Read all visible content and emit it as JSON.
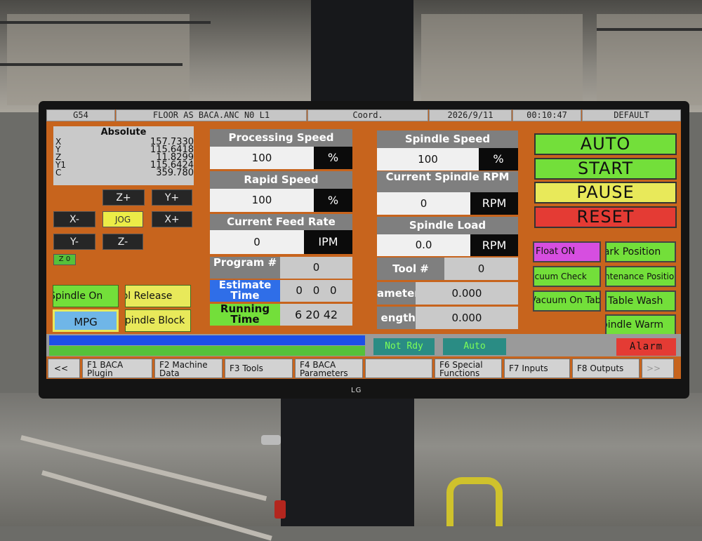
{
  "header": {
    "work_offset": "G54",
    "program_file": "FLOOR AS BACA.ANC N0 L1",
    "coord_label": "Coord.",
    "date": "2026/9/11",
    "time": "00:10:47",
    "profile": "DEFAULT"
  },
  "absolute": {
    "title": "Absolute",
    "axes": [
      "X",
      "Y",
      "Z",
      "Y1",
      "C"
    ],
    "values": [
      "157.7330",
      "115.6418",
      "11.8299",
      "115.6424",
      "359.780"
    ]
  },
  "jog": {
    "z_plus": "Z+",
    "y_plus": "Y+",
    "x_minus": "X-",
    "jog": "JOG",
    "x_plus": "X+",
    "y_minus": "Y-",
    "z_minus": "Z-",
    "z0": "Z 0"
  },
  "left_buttons": {
    "spindle_on": "Spindle On",
    "tool_release": "Tool Release",
    "mpg": "MPG",
    "spindle_block": "Spindle Block"
  },
  "processing_speed": {
    "label": "Processing Speed",
    "value": "100",
    "unit": "%"
  },
  "rapid_speed": {
    "label": "Rapid Speed",
    "value": "100",
    "unit": "%"
  },
  "feed_rate": {
    "label": "Current Feed Rate",
    "value": "0",
    "unit": "IPM"
  },
  "program_number": {
    "label": "Program #",
    "value": "0"
  },
  "estimate_time": {
    "label": "Estimate Time",
    "h": "0",
    "m": "0",
    "s": "0"
  },
  "running_time": {
    "label": "Running Time",
    "h": "6",
    "m": "20",
    "s": "42"
  },
  "spindle_speed": {
    "label": "Spindle Speed",
    "value": "100",
    "unit": "%"
  },
  "spindle_rpm": {
    "label": "Current Spindle RPM",
    "value": "0",
    "unit": "RPM"
  },
  "spindle_load": {
    "label": "Spindle Load",
    "value": "0.0",
    "unit": "RPM"
  },
  "tool_number": {
    "label": "Tool #",
    "value": "0"
  },
  "tool_diameter": {
    "label": "ameter",
    "value": "0.000"
  },
  "tool_length": {
    "label": "ength",
    "value": "0.000"
  },
  "modes": {
    "auto": "AUTO",
    "start": "START",
    "pause": "PAUSE",
    "reset": "RESET"
  },
  "right_buttons": {
    "float_on": "Float ON",
    "park_position": "Park Position",
    "vacuum_check": "Vacuum Check",
    "maintenance_position": "Maintenance Position",
    "vacuum_table": "Vacuum On Table",
    "table_wash": "Table Wash",
    "spindle_warm": "Spindle Warm"
  },
  "status": {
    "progress": 0.0,
    "ready": "Not Rdy",
    "mode": "Auto",
    "alarm": "Alarm"
  },
  "function_keys": {
    "prev": "<<",
    "f1": [
      "F1 BACA",
      "Plugin"
    ],
    "f2": [
      "F2 Machine",
      "Data"
    ],
    "f3": "F3 Tools",
    "f4": [
      "F4 BACA",
      "Parameters"
    ],
    "f6": [
      "F6 Special",
      "Functions"
    ],
    "f7": "F7 Inputs",
    "f8": "F8 Outputs",
    "next": ">>"
  },
  "monitor_brand": "LG",
  "colors": {
    "screen_bg": "#c7641d",
    "go_green": "#73df3a",
    "pause_yellow": "#e8e95a",
    "reset_red": "#e43b34",
    "progress_blue": "#1d4fe8",
    "estimate_blue": "#2f6ee8"
  }
}
